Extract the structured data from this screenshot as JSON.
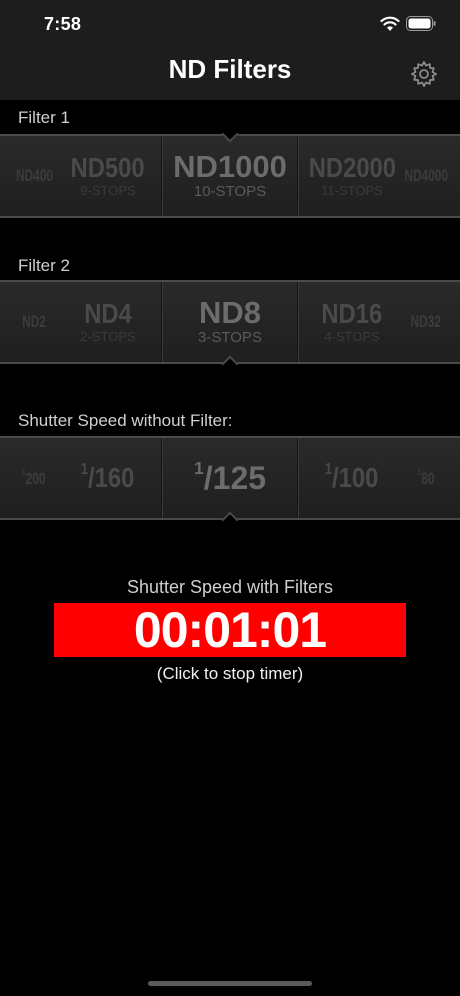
{
  "status_bar": {
    "time": "7:58"
  },
  "nav": {
    "title": "ND Filters",
    "settings_icon": "gear-icon"
  },
  "filter1": {
    "label": "Filter 1",
    "items": [
      {
        "main": "ND400",
        "sub": ""
      },
      {
        "main": "ND500",
        "sub": "9-STOPS"
      },
      {
        "main": "ND1000",
        "sub": "10-STOPS"
      },
      {
        "main": "ND2000",
        "sub": "11-STOPS"
      },
      {
        "main": "ND4000",
        "sub": ""
      }
    ],
    "selected_index": 2
  },
  "filter2": {
    "label": "Filter 2",
    "items": [
      {
        "main": "ND2",
        "sub": ""
      },
      {
        "main": "ND4",
        "sub": "2-STOPS"
      },
      {
        "main": "ND8",
        "sub": "3-STOPS"
      },
      {
        "main": "ND16",
        "sub": "4-STOPS"
      },
      {
        "main": "ND32",
        "sub": ""
      }
    ],
    "selected_index": 2
  },
  "shutter": {
    "label": "Shutter Speed without Filter:",
    "items": [
      {
        "num": "1",
        "den": "200"
      },
      {
        "num": "1",
        "den": "160"
      },
      {
        "num": "1",
        "den": "125"
      },
      {
        "num": "1",
        "den": "100"
      },
      {
        "num": "1",
        "den": "80"
      }
    ],
    "selected_index": 2
  },
  "result": {
    "label": "Shutter Speed with Filters",
    "timer": "00:01:01",
    "hint": "(Click to stop timer)"
  },
  "colors": {
    "background": "#000000",
    "bar": "#1d1d1d",
    "timer_bg": "#ff0000"
  }
}
